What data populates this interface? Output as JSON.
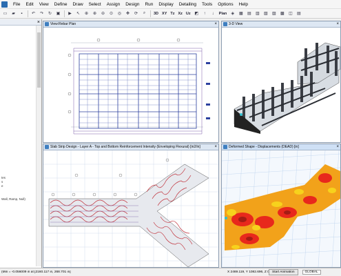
{
  "menubar": {
    "items": [
      "File",
      "Edit",
      "View",
      "Define",
      "Draw",
      "Select",
      "Assign",
      "Design",
      "Run",
      "Display",
      "Detailing",
      "Tools",
      "Options",
      "Help"
    ]
  },
  "toolbar": {
    "view_labels": [
      "3D",
      "XY",
      "Tz",
      "Xz",
      "Uz"
    ],
    "plan_label": "Plan"
  },
  "sidepanel": {
    "close_glyph": "×",
    "lines": [
      "tes",
      "s",
      "e",
      "Wall, Ramp, Null)"
    ]
  },
  "windows": {
    "rebar_plan": {
      "title": "View:Rebar Plan",
      "close": "×"
    },
    "three_d": {
      "title": "3-D View",
      "close": "×"
    },
    "slab_strip": {
      "title": "Slab Strip Design - Layer A - Top and Bottom Reinforcement Intensity (Enveloping Flexural) [in2/in]",
      "close": "×"
    },
    "deformed": {
      "title": "Deformed Shape - Displacements (DEAD) [in]",
      "close": "×"
    }
  },
  "statusbar": {
    "message": "(Min = -0.056009 in at [2160.117 in, 268.701 in]",
    "coords": "X 2469.119, Y 1082.696, Z 0 (in)",
    "start_animation": "Start Animation",
    "units": "GLOBAL"
  },
  "colors": {
    "title_bg": "#dde7f3",
    "rebar_blue": "#2b3f9e",
    "strip_red": "#c0303a",
    "deform_red": "#e8281c",
    "deform_yellow": "#f7d21c",
    "grid_blue": "#b9d1ee"
  }
}
